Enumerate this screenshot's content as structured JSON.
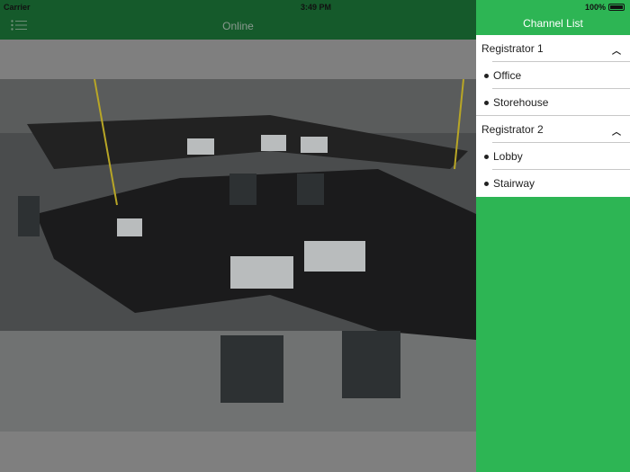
{
  "status_bar": {
    "carrier": "Carrier",
    "time": "3:49 PM",
    "battery": "100%"
  },
  "header": {
    "title": "Online"
  },
  "drawer": {
    "title": "Channel List",
    "groups": [
      {
        "label": "Registrator 1",
        "channels": [
          "Office",
          "Storehouse"
        ]
      },
      {
        "label": "Registrator 2",
        "channels": [
          "Lobby",
          "Stairway"
        ]
      }
    ]
  },
  "colors": {
    "header": "#155a2b",
    "drawer": "#2db554"
  }
}
